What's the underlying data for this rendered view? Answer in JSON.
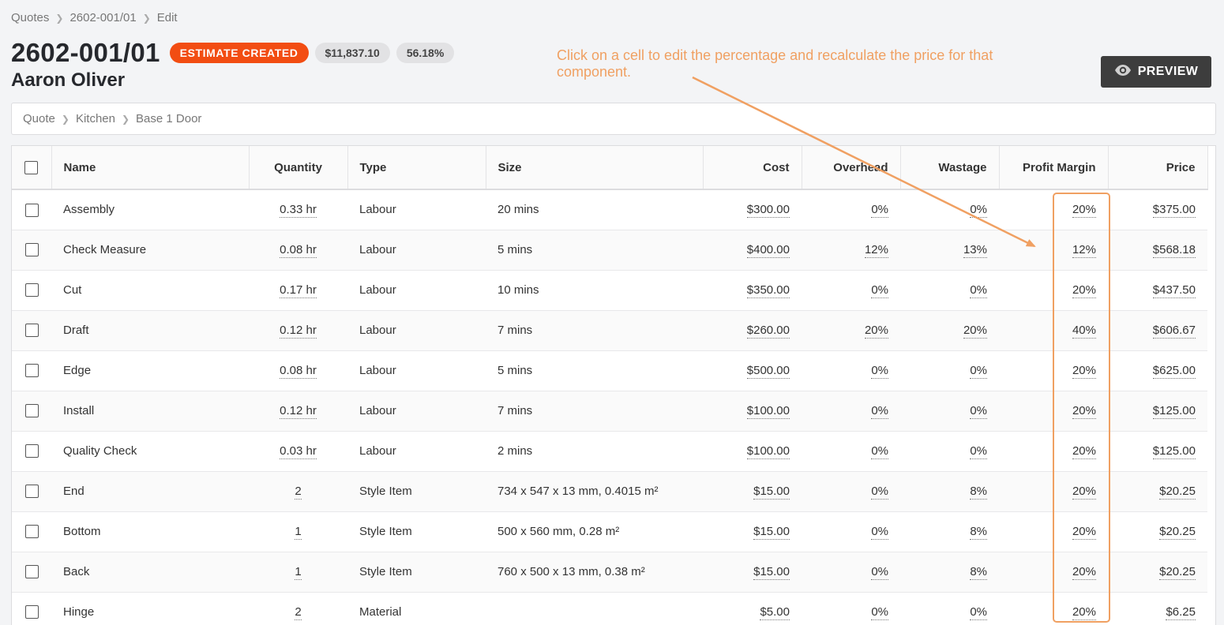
{
  "breadcrumb_top": [
    "Quotes",
    "2602-001/01",
    "Edit"
  ],
  "quote": {
    "number": "2602-001/01",
    "status": "ESTIMATE CREATED",
    "total": "$11,837.10",
    "margin": "56.18%",
    "customer": "Aaron Oliver"
  },
  "preview_button": {
    "label": "PREVIEW",
    "icon": "eye-icon"
  },
  "breadcrumb_section": [
    "Quote",
    "Kitchen",
    "Base 1 Door"
  ],
  "annotation": {
    "text": "Click on a cell to edit the percentage and recalculate the price for that component.",
    "color": "#f0a062"
  },
  "colors": {
    "status_badge": "#f24d12",
    "preview_button": "#3d3d3d",
    "annotation": "#f0a062"
  },
  "table": {
    "columns": [
      "Name",
      "Quantity",
      "Type",
      "Size",
      "Cost",
      "Overhead",
      "Wastage",
      "Profit Margin",
      "Price"
    ],
    "rows": [
      {
        "name": "Assembly",
        "quantity": "0.33 hr",
        "type": "Labour",
        "size": "20 mins",
        "cost": "$300.00",
        "overhead": "0%",
        "wastage": "0%",
        "profit_margin": "20%",
        "price": "$375.00"
      },
      {
        "name": "Check Measure",
        "quantity": "0.08 hr",
        "type": "Labour",
        "size": "5 mins",
        "cost": "$400.00",
        "overhead": "12%",
        "wastage": "13%",
        "profit_margin": "12%",
        "price": "$568.18"
      },
      {
        "name": "Cut",
        "quantity": "0.17 hr",
        "type": "Labour",
        "size": "10 mins",
        "cost": "$350.00",
        "overhead": "0%",
        "wastage": "0%",
        "profit_margin": "20%",
        "price": "$437.50"
      },
      {
        "name": "Draft",
        "quantity": "0.12 hr",
        "type": "Labour",
        "size": "7 mins",
        "cost": "$260.00",
        "overhead": "20%",
        "wastage": "20%",
        "profit_margin": "40%",
        "price": "$606.67"
      },
      {
        "name": "Edge",
        "quantity": "0.08 hr",
        "type": "Labour",
        "size": "5 mins",
        "cost": "$500.00",
        "overhead": "0%",
        "wastage": "0%",
        "profit_margin": "20%",
        "price": "$625.00"
      },
      {
        "name": "Install",
        "quantity": "0.12 hr",
        "type": "Labour",
        "size": "7 mins",
        "cost": "$100.00",
        "overhead": "0%",
        "wastage": "0%",
        "profit_margin": "20%",
        "price": "$125.00"
      },
      {
        "name": "Quality Check",
        "quantity": "0.03 hr",
        "type": "Labour",
        "size": "2 mins",
        "cost": "$100.00",
        "overhead": "0%",
        "wastage": "0%",
        "profit_margin": "20%",
        "price": "$125.00"
      },
      {
        "name": "End",
        "quantity": "2",
        "type": "Style Item",
        "size": "734 x 547 x 13 mm, 0.4015 m²",
        "cost": "$15.00",
        "overhead": "0%",
        "wastage": "8%",
        "profit_margin": "20%",
        "price": "$20.25"
      },
      {
        "name": "Bottom",
        "quantity": "1",
        "type": "Style Item",
        "size": "500 x 560 mm, 0.28 m²",
        "cost": "$15.00",
        "overhead": "0%",
        "wastage": "8%",
        "profit_margin": "20%",
        "price": "$20.25"
      },
      {
        "name": "Back",
        "quantity": "1",
        "type": "Style Item",
        "size": "760 x 500 x 13 mm, 0.38 m²",
        "cost": "$15.00",
        "overhead": "0%",
        "wastage": "8%",
        "profit_margin": "20%",
        "price": "$20.25"
      },
      {
        "name": "Hinge",
        "quantity": "2",
        "type": "Material",
        "size": "",
        "cost": "$5.00",
        "overhead": "0%",
        "wastage": "0%",
        "profit_margin": "20%",
        "price": "$6.25"
      }
    ]
  }
}
